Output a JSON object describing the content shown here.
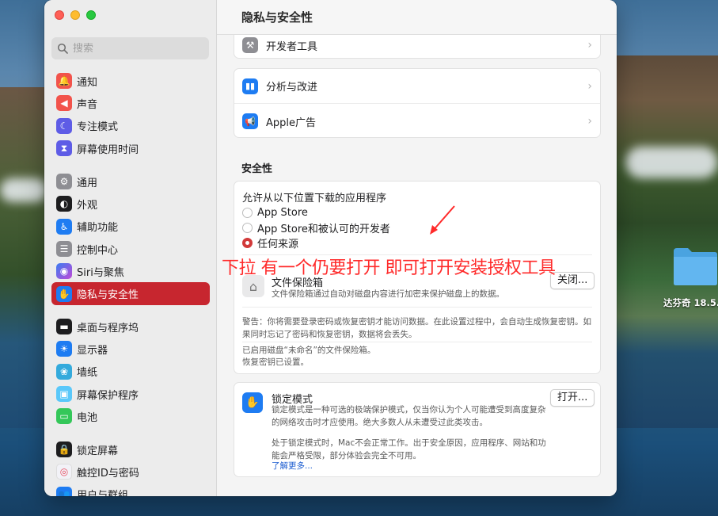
{
  "window_title": "隐私与安全性",
  "search": {
    "placeholder": "搜索"
  },
  "sidebar": {
    "group1": [
      {
        "label": "通知",
        "icon": "bell-icon",
        "color": "#f2534b"
      },
      {
        "label": "声音",
        "icon": "speaker-icon",
        "color": "#f2534b"
      },
      {
        "label": "专注模式",
        "icon": "moon-icon",
        "color": "#5e5ce6"
      },
      {
        "label": "屏幕使用时间",
        "icon": "hourglass-icon",
        "color": "#5e5ce6"
      }
    ],
    "group2": [
      {
        "label": "通用",
        "icon": "gear-icon",
        "color": "#8e8e93"
      },
      {
        "label": "外观",
        "icon": "appearance-icon",
        "color": "#1d1d1f"
      },
      {
        "label": "辅助功能",
        "icon": "accessibility-icon",
        "color": "#1e7cf2"
      },
      {
        "label": "控制中心",
        "icon": "control-center-icon",
        "color": "#8e8e93"
      },
      {
        "label": "Siri与聚焦",
        "icon": "siri-icon",
        "color": "#8d5cf6"
      },
      {
        "label": "隐私与安全性",
        "icon": "hand-icon",
        "color": "#1e7cf2",
        "active": true
      }
    ],
    "group3": [
      {
        "label": "桌面与程序坞",
        "icon": "dock-icon",
        "color": "#1d1d1f"
      },
      {
        "label": "显示器",
        "icon": "sun-icon",
        "color": "#1e7cf2"
      },
      {
        "label": "墙纸",
        "icon": "flower-icon",
        "color": "#34aadc"
      },
      {
        "label": "屏幕保护程序",
        "icon": "screensaver-icon",
        "color": "#5ac8fa"
      },
      {
        "label": "电池",
        "icon": "battery-icon",
        "color": "#34c759"
      }
    ],
    "group4": [
      {
        "label": "锁定屏幕",
        "icon": "lock-icon",
        "color": "#1d1d1f"
      },
      {
        "label": "触控ID与密码",
        "icon": "fingerprint-icon",
        "color": "#f2f2f7"
      },
      {
        "label": "用户与群组",
        "icon": "users-icon",
        "color": "#1e7cf2"
      }
    ]
  },
  "main": {
    "rows_top": [
      {
        "label": "开发者工具",
        "icon": "hammer-icon"
      },
      {
        "label": "分析与改进",
        "icon": "chart-icon"
      },
      {
        "label": "Apple广告",
        "icon": "megaphone-icon"
      }
    ],
    "security_title": "安全性",
    "allow_title": "允许从以下位置下载的应用程序",
    "options": [
      "App Store",
      "App Store和被认可的开发者",
      "任何来源"
    ],
    "selected_option": 2,
    "filevault": {
      "title": "文件保险箱",
      "desc": "文件保险箱通过自动对磁盘内容进行加密来保护磁盘上的数据。",
      "button": "关闭...",
      "warning": "警告：你将需要登录密码或恢复密钥才能访问数据。在此设置过程中，会自动生成恢复密钥。如果同时忘记了密码和恢复密钥，数据将会丢失。",
      "status1": "已启用磁盘“未命名”的文件保险箱。",
      "status2": "恢复密钥已设置。"
    },
    "lockdown": {
      "title": "锁定模式",
      "desc": "锁定模式是一种可选的极端保护模式，仅当你认为个人可能遭受到高度复杂的网络攻击时才应使用。绝大多数人从未遭受过此类攻击。",
      "desc2": "处于锁定模式时，Mac不会正常工作。出于安全原因，应用程序、网站和功能会严格受限，部分体验会完全不可用。",
      "link": "了解更多...",
      "button": "打开..."
    }
  },
  "annotation": "下拉 有一个仍要打开 即可打开安装授权工具",
  "desktop": {
    "folder_label": "达芬奇 18.5."
  }
}
